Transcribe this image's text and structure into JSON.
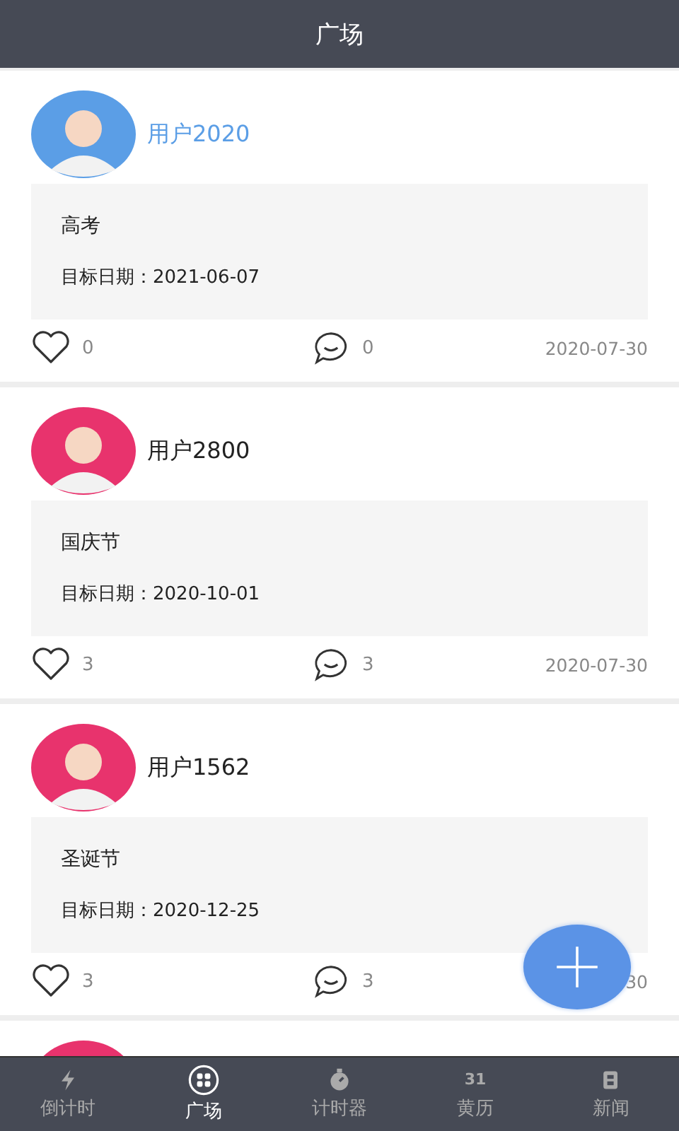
{
  "header": {
    "title": "广场"
  },
  "posts": [
    {
      "user": "用户2020",
      "highlighted": true,
      "color": "#5b9ee6",
      "title": "高考",
      "target_label": "目标日期：",
      "target_date": "2021-06-07",
      "likes": "0",
      "comments": "0",
      "date": "2020-07-30"
    },
    {
      "user": "用户2800",
      "highlighted": false,
      "color": "#e8336d",
      "title": "国庆节",
      "target_label": "目标日期：",
      "target_date": "2020-10-01",
      "likes": "3",
      "comments": "3",
      "date": "2020-07-30"
    },
    {
      "user": "用户1562",
      "highlighted": false,
      "color": "#e8336d",
      "title": "圣诞节",
      "target_label": "目标日期：",
      "target_date": "2020-12-25",
      "likes": "3",
      "comments": "3",
      "date": "30"
    }
  ],
  "next_post": {
    "color": "#e8336d"
  },
  "nav": [
    {
      "kind": "bolt",
      "label": "倒计时",
      "selected": false
    },
    {
      "kind": "grid",
      "label": "广场",
      "selected": true
    },
    {
      "kind": "timer",
      "label": "计时器",
      "selected": false
    },
    {
      "kind": "calendar",
      "icon_text": "31",
      "label": "黄历",
      "selected": false
    },
    {
      "kind": "news",
      "label": "新闻",
      "selected": false
    }
  ]
}
